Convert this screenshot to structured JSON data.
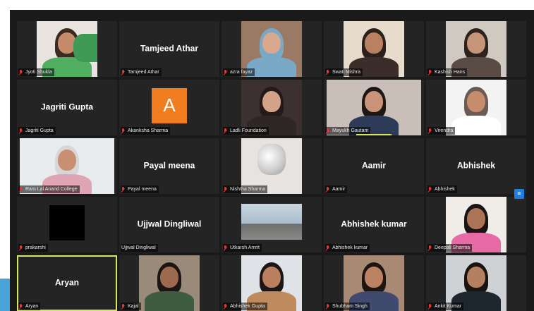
{
  "participants": [
    {
      "name": "Jyoti Shukla",
      "tile": "video",
      "scene": "green"
    },
    {
      "name": "Tamjeed Athar",
      "tile": "name"
    },
    {
      "name": "azra fayaz",
      "tile": "video",
      "scene": "hijab"
    },
    {
      "name": "Swati Mishra",
      "tile": "video",
      "scene": "beige"
    },
    {
      "name": "Kashish Hans",
      "tile": "video",
      "scene": "room"
    },
    {
      "name": "Jagriti Gupta",
      "tile": "name"
    },
    {
      "name": "Akanksha Sharma",
      "tile": "avatar",
      "initial": "A"
    },
    {
      "name": "Ladli Foundation",
      "tile": "video",
      "scene": "dark-room"
    },
    {
      "name": "Mayukh Gautam",
      "tile": "video",
      "scene": "map"
    },
    {
      "name": "Virendra",
      "tile": "video",
      "scene": "white"
    },
    {
      "name": "Ram Lal Anand College",
      "tile": "video",
      "scene": "office"
    },
    {
      "name": "Payal meena",
      "tile": "name"
    },
    {
      "name": "Nishtha Sharma",
      "tile": "video",
      "scene": "crystal"
    },
    {
      "name": "Aamir",
      "tile": "name"
    },
    {
      "name": "Abhishek",
      "tile": "name"
    },
    {
      "name": "prakarshi",
      "tile": "black"
    },
    {
      "name": "Ujjwal Dingliwal",
      "tile": "name"
    },
    {
      "name": "Utkarsh Amrit",
      "tile": "video",
      "scene": "sky"
    },
    {
      "name": "Abhishek kumar",
      "tile": "name"
    },
    {
      "name": "Deepali Sharma",
      "tile": "video",
      "scene": "pink"
    },
    {
      "name": "Aryan",
      "tile": "name",
      "speaker": true
    },
    {
      "name": "Kajal",
      "tile": "video",
      "scene": "outdoor"
    },
    {
      "name": "Abhishek Gupta",
      "tile": "video",
      "scene": "lightwall"
    },
    {
      "name": "Shubham Singh",
      "tile": "video",
      "scene": "brownroom"
    },
    {
      "name": "Ankit Kumar",
      "tile": "video",
      "scene": "grey"
    }
  ],
  "colors": {
    "speaker_border": "#d6e85a",
    "avatar_bg": "#f07d1f",
    "muted_mic": "#e03a3a"
  }
}
